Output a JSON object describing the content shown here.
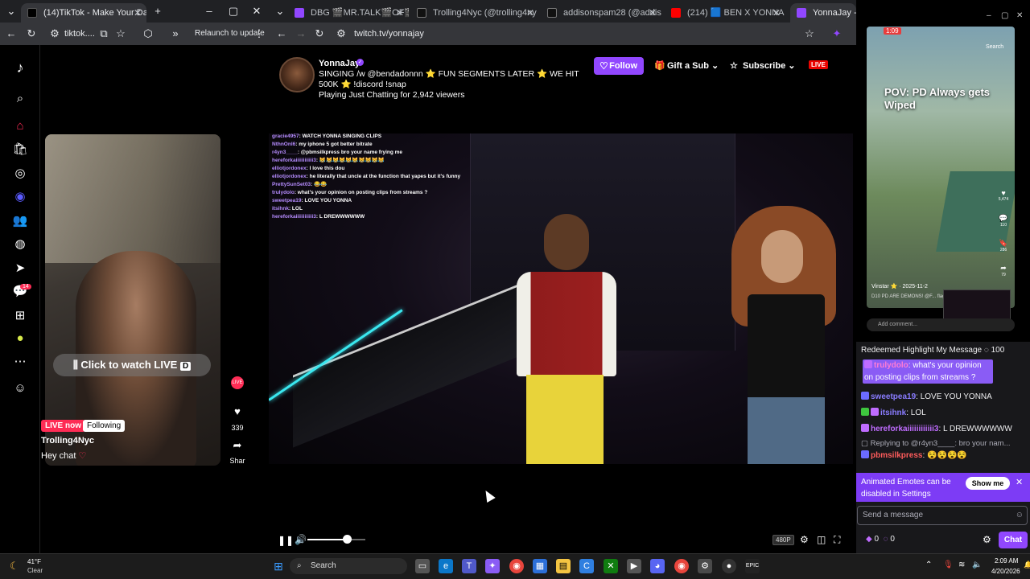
{
  "left_browser": {
    "tabs": [
      {
        "label": "(14)TikTok - Make Your Day",
        "active": true
      }
    ],
    "url": "tiktok....",
    "relaunch_label": "Relaunch to update",
    "sidebar_icons": [
      "tiktok-logo",
      "search-icon",
      "home-icon",
      "shop-icon",
      "explore-icon",
      "live-icon",
      "following-icon",
      "profile-icon",
      "send-icon",
      "inbox-icon",
      "upload-icon",
      "coin-icon",
      "more-icon",
      "avatar"
    ],
    "inbox_badge": "14",
    "video": {
      "watch_label": "Click to watch LIVE",
      "watch_key": "D",
      "live_badge": "LIVE now",
      "following_badge": "Following",
      "username": "Trolling4Nyc",
      "caption": "Hey chat",
      "like_count": "339",
      "share_label": "Shar"
    }
  },
  "main_browser": {
    "tabs": [
      {
        "label": "DBG 🎬MR.TALK🎬OF🎬 DA 🔥",
        "color": "#9147ff"
      },
      {
        "label": "Trolling4Nyc (@trolling4ny",
        "color": "#ffffff"
      },
      {
        "label": "addisonspam28 (@addisonsp",
        "color": "#ffffff"
      },
      {
        "label": "(214) 🟦 BEN X YONNA 🟦 L/",
        "color": "#ff0000"
      },
      {
        "label": "YonnaJay - Twitc",
        "color": "#9147ff"
      }
    ],
    "url": "twitch.tv/yonnajay",
    "stream": {
      "streamer": "YonnaJay",
      "title": "SINGING /w @bendadonnn ⭐ FUN SEGMENTS LATER ⭐ WE HIT 500K ⭐ !discord !snap",
      "game_line": "Playing Just Chatting for 2,942 viewers",
      "follow_label": "Follow",
      "gift_label": "Gift a Sub",
      "subscribe_label": "Subscribe",
      "live_label": "LIVE",
      "quality": "480P",
      "volume": 0.68
    },
    "overlay_chat": [
      {
        "name": "gracie4957",
        "msg": "WATCH YONNA SINGING CLIPS"
      },
      {
        "name": "NthnOnl6",
        "msg": "my iphone 5 got better bitrate"
      },
      {
        "name": "r4yn3____",
        "msg": "@pbmsilkpress bro your name frying me"
      },
      {
        "name": "hereforkaiiiiiiiiiiii3",
        "msg": "😹😹😹😹😹😹😹😹😹😹"
      },
      {
        "name": "elliotjordonex",
        "msg": "I love this dou"
      },
      {
        "name": "elliotjordonex",
        "msg": "he literally that uncle at the function that yapes but it's funny"
      },
      {
        "name": "PrettySunSet03",
        "msg": "😂😂"
      },
      {
        "name": "trulydolo",
        "msg": "what's your opinion on posting clips from streams ?"
      },
      {
        "name": "sweetpea19",
        "msg": "LOVE YOU YONNA"
      },
      {
        "name": "itsihnk",
        "msg": "LOL"
      },
      {
        "name": "hereforkaiiiiiiiiiiii3",
        "msg": "L DREWWWWWW"
      }
    ]
  },
  "mini_video": {
    "time": "1:09",
    "search_label": "Search",
    "caption": "POV: PD Always gets Wiped",
    "user": "Vinstar ⭐ · 2025-11-2",
    "desc": "D10 PD ARE DEMONS! @F... flags getting clapped up #",
    "counts": [
      "5,474",
      "110",
      "286",
      "79"
    ],
    "comment_placeholder": "Add comment..."
  },
  "chat": {
    "redeem_line": "Redeemed Highlight My Message",
    "redeem_points": "100",
    "highlight_name": "trulydolo",
    "highlight_msg": "what's your opinion on posting clips from streams ?",
    "messages": [
      {
        "name": "sweetpea19",
        "msg": "LOVE YOU YONNA",
        "color": "#8a7cff"
      },
      {
        "name": "itsihnk",
        "msg": "LOL",
        "color": "#8a7cff"
      },
      {
        "name": "hereforkaiiiiiiiiiiii3",
        "msg": "L DREWWWWWW",
        "color": "#bf6cff"
      }
    ],
    "reply_line": "Replying to @r4yn3____: bro your nam...",
    "reply_name": "pbmsilkpress",
    "reply_msg": "😵😵😵😵",
    "emote_banner": "Animated Emotes can be disabled in Settings",
    "show_me_label": "Show me",
    "input_placeholder": "Send a message",
    "points_a": "0",
    "points_b": "0",
    "chat_button": "Chat"
  },
  "taskbar": {
    "weather_temp": "41°F",
    "weather_desc": "Clear",
    "search_label": "Search",
    "time": "2:09 AM",
    "date": "4/20/2026",
    "epic_label": "EPIC"
  }
}
